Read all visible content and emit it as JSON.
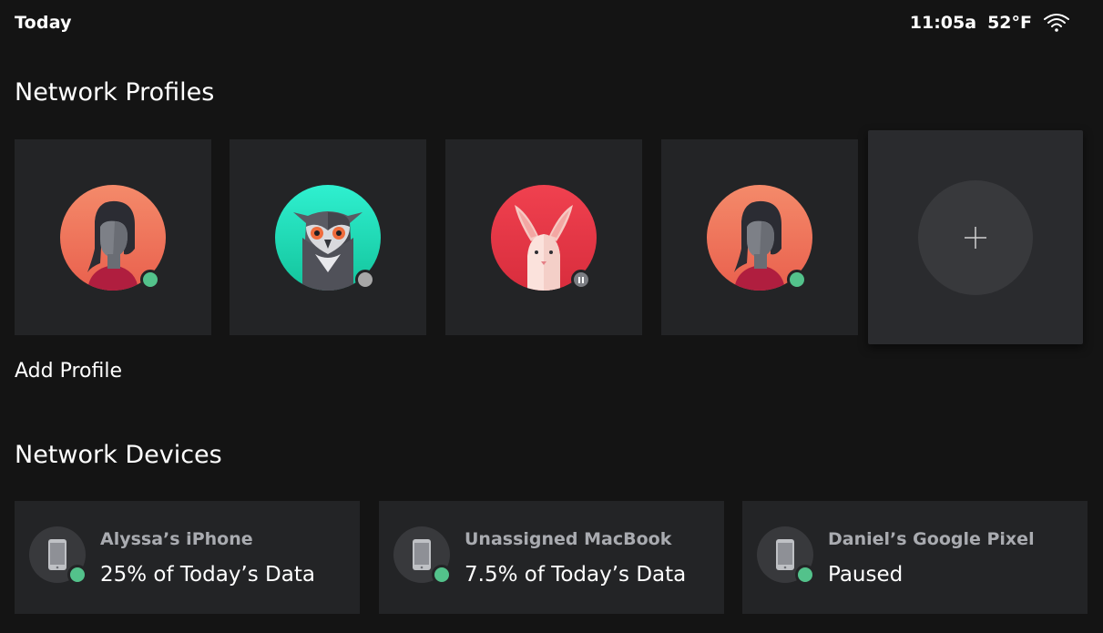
{
  "topbar": {
    "title": "Today",
    "time": "11:05a",
    "temperature": "52°F",
    "wifi_icon": "wifi-icon"
  },
  "profiles": {
    "title": "Network Profiles",
    "add_label": "Add Profile",
    "items": [
      {
        "avatar": "girl-avatar",
        "status": "online",
        "status_color": "#53c28b"
      },
      {
        "avatar": "owl-avatar",
        "status": "offline",
        "status_color": "#a7a7a7"
      },
      {
        "avatar": "rabbit-avatar",
        "status": "paused",
        "status_color": "#7c7e83"
      },
      {
        "avatar": "girl-avatar",
        "status": "online",
        "status_color": "#53c28b"
      }
    ],
    "add_icon": "plus-icon"
  },
  "devices": {
    "title": "Network Devices",
    "items": [
      {
        "name": "Alyssa’s iPhone",
        "usage": "25% of Today’s Data",
        "icon": "phone-icon"
      },
      {
        "name": "Unassigned MacBook",
        "usage": "7.5% of Today’s Data",
        "icon": "phone-icon"
      },
      {
        "name": "Daniel’s Google Pixel",
        "usage": "Paused",
        "icon": "phone-icon"
      }
    ]
  },
  "colors": {
    "background": "#141414",
    "card": "#232426",
    "online": "#53c28b",
    "secondary_text": "#a9abb0"
  }
}
